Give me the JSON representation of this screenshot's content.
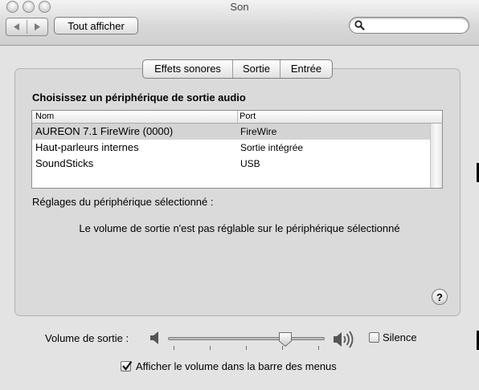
{
  "window": {
    "title": "Son"
  },
  "toolbar": {
    "show_all_label": "Tout afficher",
    "back_icon": "back-arrow-icon",
    "forward_icon": "forward-arrow-icon",
    "search": {
      "placeholder": "",
      "value": "",
      "icon": "search-icon"
    }
  },
  "tabs": [
    {
      "label": "Effets sonores",
      "selected": false
    },
    {
      "label": "Sortie",
      "selected": true
    },
    {
      "label": "Entrée",
      "selected": false
    }
  ],
  "output": {
    "heading": "Choisissez un périphérique de sortie audio",
    "columns": [
      "Nom",
      "Port"
    ],
    "devices": [
      {
        "name": "AUREON 7.1 FireWire (0000)",
        "port": "FireWire",
        "selected": true
      },
      {
        "name": "Haut-parleurs internes",
        "port": "Sortie intégrée",
        "selected": false
      },
      {
        "name": "SoundSticks",
        "port": "USB",
        "selected": false
      }
    ],
    "settings_label": "Réglages du périphérique sélectionné :",
    "volume_message": "Le volume de sortie n'est pas réglable sur le périphérique sélectionné",
    "help_label": "?"
  },
  "volume": {
    "label": "Volume de sortie :",
    "level": 0.75,
    "silence_label": "Silence",
    "silence_checked": false,
    "show_in_menu_label": "Afficher le volume dans la barre des menus",
    "show_in_menu_checked": true
  },
  "colors": {
    "selection": "#d4d4d4",
    "window": "#e3e3e3",
    "panel": "#dadada"
  }
}
